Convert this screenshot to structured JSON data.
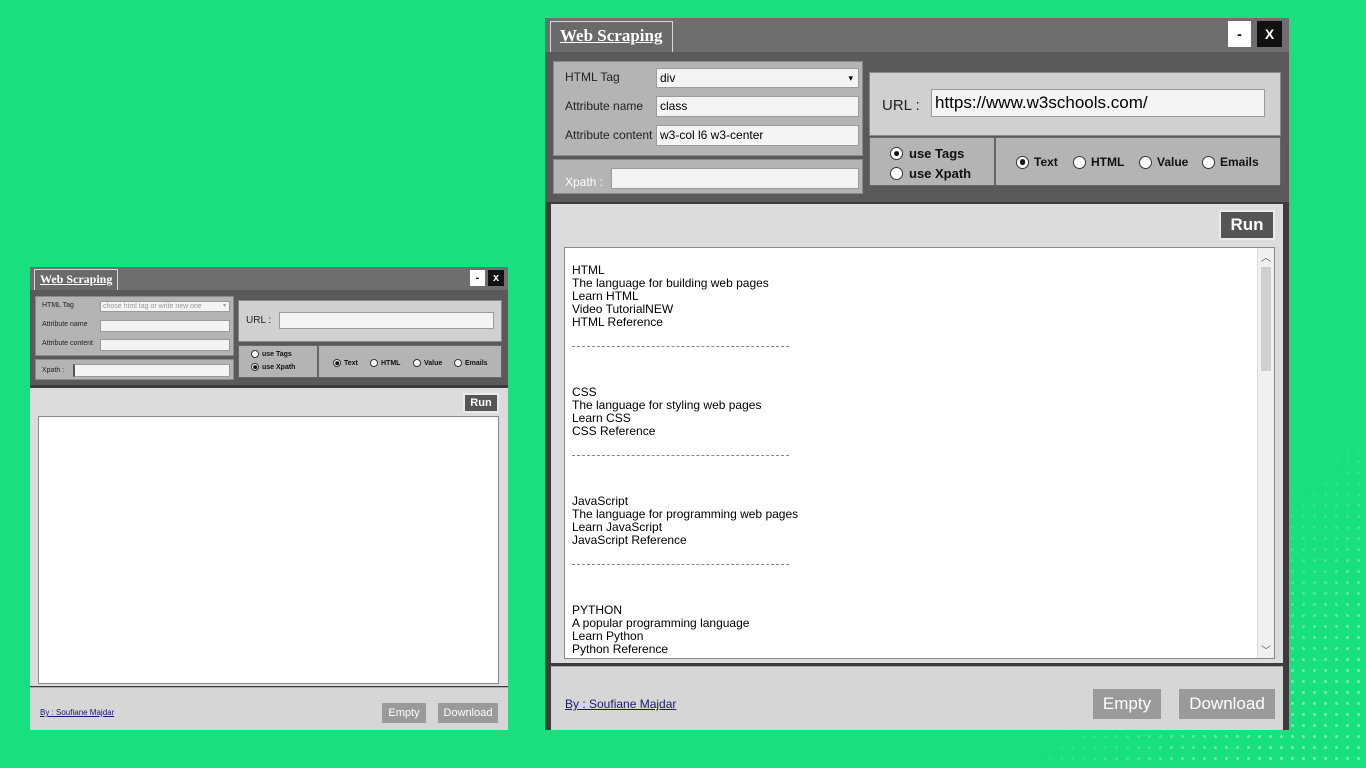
{
  "small_window": {
    "title": "Web Scraping",
    "min_label": "-",
    "close_label": "x",
    "html_tag_label": "HTML Tag",
    "html_tag_placeholder": "chose html tag or write new one",
    "attr_name_label": "Attribute name",
    "attr_content_label": "Attribute content",
    "xpath_label": "Xpath :",
    "url_label": "URL :",
    "use_tags": "use Tags",
    "use_xpath": "use Xpath",
    "options": [
      "Text",
      "HTML",
      "Value",
      "Emails"
    ],
    "run": "Run",
    "author": "By : Soufiane Majdar",
    "empty": "Empty",
    "download": "Download"
  },
  "large_window": {
    "title": "Web Scraping",
    "min_label": "-",
    "close_label": "X",
    "html_tag_label": "HTML Tag",
    "html_tag_value": "div",
    "attr_name_label": "Attribute name",
    "attr_name_value": "class",
    "attr_content_label": "Attribute content",
    "attr_content_value": "w3-col l6 w3-center",
    "xpath_label": "Xpath :",
    "url_label": "URL :",
    "url_value": "https://www.w3schools.com/",
    "use_tags": "use Tags",
    "use_xpath": "use Xpath",
    "options": [
      "Text",
      "HTML",
      "Value",
      "Emails"
    ],
    "run": "Run",
    "author": "By : Soufiane Majdar",
    "empty": "Empty",
    "download": "Download",
    "output": {
      "blocks": [
        [
          "HTML",
          "The language for building web pages",
          "Learn HTML",
          "Video TutorialNEW",
          "HTML Reference"
        ],
        [
          "CSS",
          "The language for styling web pages",
          "Learn CSS",
          "CSS Reference"
        ],
        [
          "JavaScript",
          "The language for programming web pages",
          "Learn JavaScript",
          "JavaScript Reference"
        ],
        [
          "PYTHON",
          "A popular programming language",
          "Learn Python",
          "Python Reference"
        ]
      ]
    }
  }
}
